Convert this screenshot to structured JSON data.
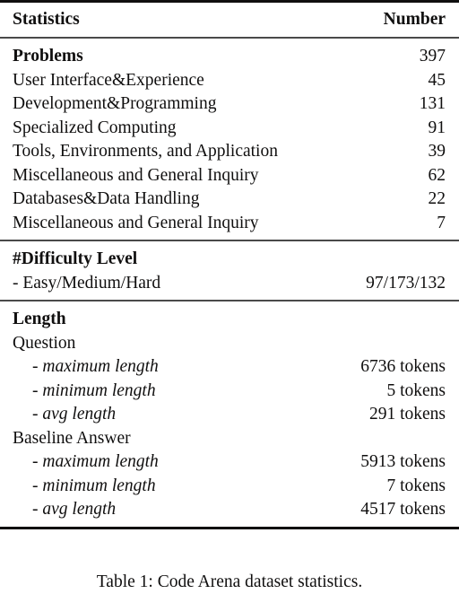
{
  "table": {
    "header": {
      "label": "Statistics",
      "value": "Number"
    },
    "sections": [
      {
        "title": "Problems",
        "title_value": "397",
        "rows": [
          {
            "label": "User Interface&Experience",
            "value": "45"
          },
          {
            "label": "Development&Programming",
            "value": "131"
          },
          {
            "label": "Specialized Computing",
            "value": "91"
          },
          {
            "label": "Tools, Environments, and Application",
            "value": "39"
          },
          {
            "label": "Miscellaneous and General Inquiry",
            "value": "62"
          },
          {
            "label": "Databases&Data Handling",
            "value": "22"
          },
          {
            "label": "Miscellaneous and General Inquiry",
            "value": "7"
          }
        ]
      },
      {
        "title": "#Difficulty Level",
        "title_value": "",
        "rows": [
          {
            "label": "- Easy/Medium/Hard",
            "value": "97/173/132"
          }
        ]
      },
      {
        "title": "Length",
        "title_value": "",
        "groups": [
          {
            "name": "Question",
            "items": [
              {
                "dash": "- ",
                "label": "maximum length",
                "value": "6736 tokens"
              },
              {
                "dash": "- ",
                "label": "minimum length",
                "value": "5 tokens"
              },
              {
                "dash": "- ",
                "label": "avg length",
                "value": "291 tokens"
              }
            ]
          },
          {
            "name": "Baseline Answer",
            "items": [
              {
                "dash": "- ",
                "label": "maximum length",
                "value": "5913 tokens"
              },
              {
                "dash": "- ",
                "label": "minimum length",
                "value": "7 tokens"
              },
              {
                "dash": "- ",
                "label": "avg length",
                "value": "4517 tokens"
              }
            ]
          }
        ]
      }
    ]
  },
  "caption": {
    "text": "Table 1: Code Arena dataset statistics."
  }
}
